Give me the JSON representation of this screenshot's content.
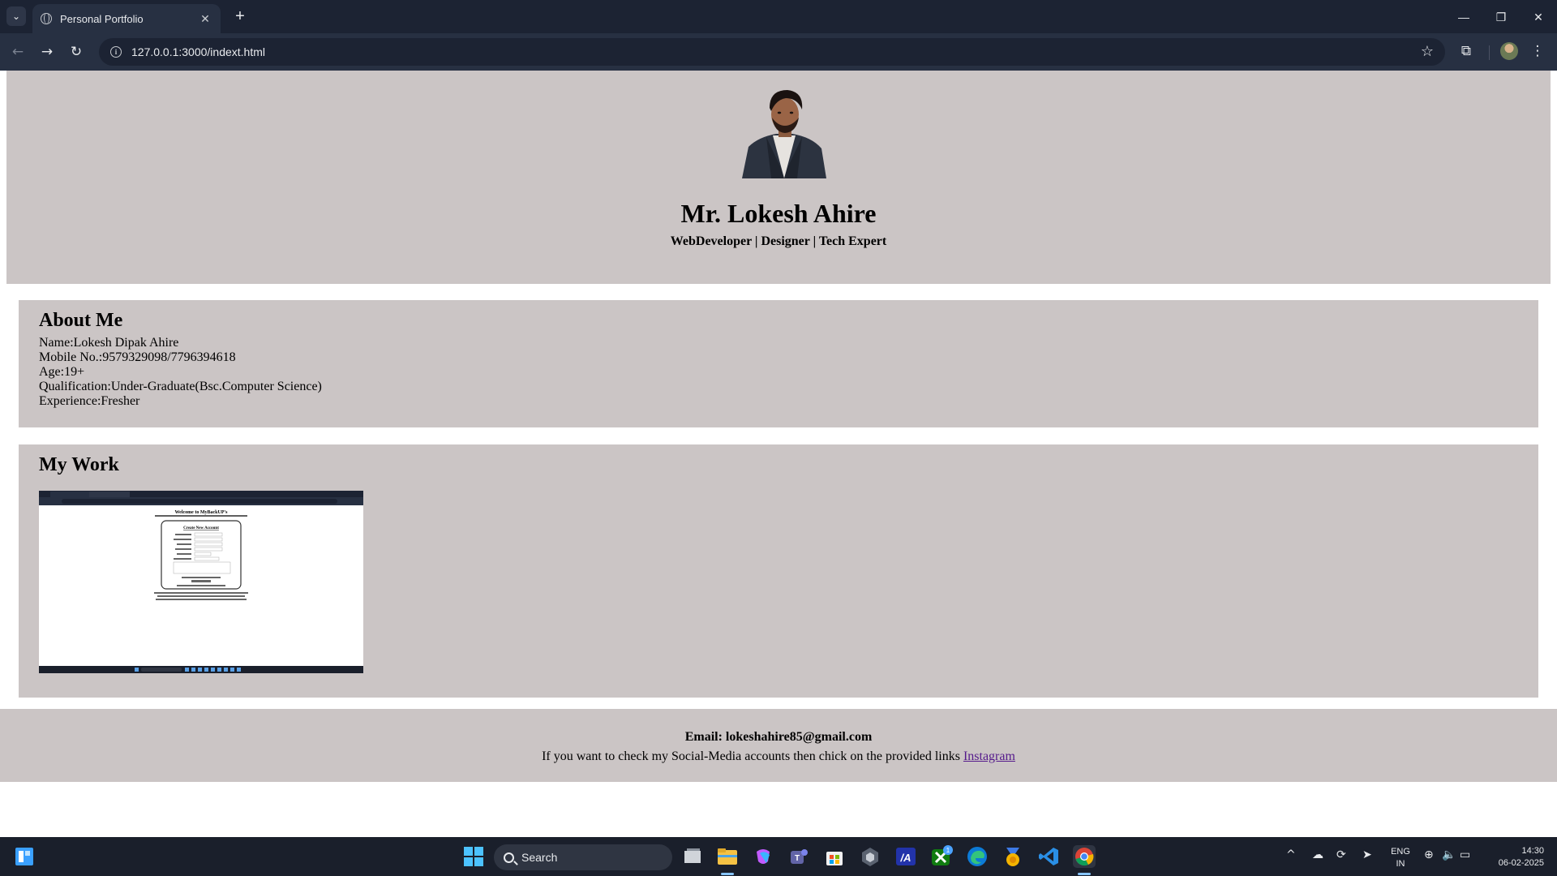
{
  "browser": {
    "tab_title": "Personal Portfolio",
    "url": "127.0.0.1:3000/indext.html"
  },
  "header": {
    "name": "Mr. Lokesh Ahire",
    "tagline": "WebDeveloper | Designer | Tech Expert"
  },
  "about": {
    "heading": "About Me",
    "lines": [
      "Name:Lokesh Dipak Ahire",
      "Mobile No.:9579329098/7796394618",
      "Age:19+",
      "Qualification:Under-Graduate(Bsc.Computer Science)",
      "Experience:Fresher"
    ]
  },
  "work": {
    "heading": "My Work",
    "thumbnail": {
      "title": "Welcome to MyBackUP's",
      "form_title": "Create New Account"
    }
  },
  "footer": {
    "email": "Email: lokeshahire85@gmail.com",
    "social_text": "If you want to check my Social-Media accounts then chick on the provided links",
    "social_link": "Instagram"
  },
  "taskbar": {
    "search_label": "Search",
    "lang_top": "ENG",
    "lang_bottom": "IN",
    "time": "14:30",
    "date": "06-02-2025",
    "xbox_badge": "1"
  },
  "colors": {
    "section_bg": "#cbc5c5",
    "chrome_dark": "#1c2333",
    "chrome_toolbar": "#273042",
    "taskbar_bg": "#1a1f2b",
    "link_visited": "#551a8b"
  }
}
